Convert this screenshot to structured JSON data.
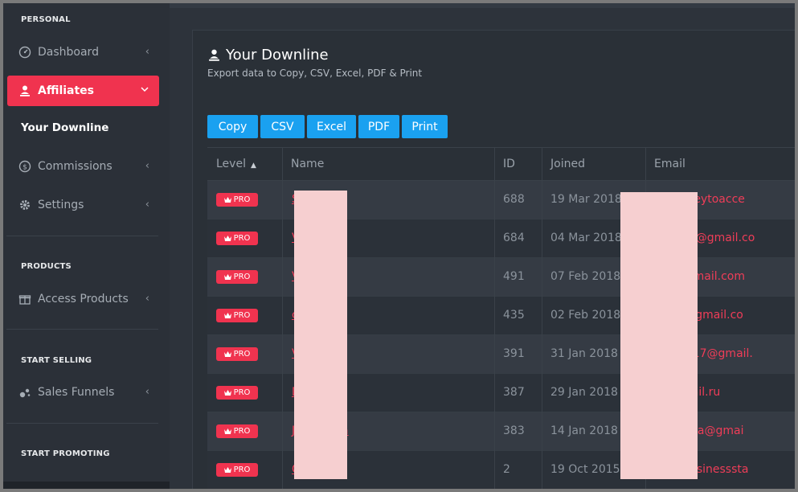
{
  "sidebar": {
    "sections": {
      "personal": "PERSONAL",
      "products": "PRODUCTS",
      "start_selling": "START SELLING",
      "start_promoting": "START PROMOTING"
    },
    "items": {
      "dashboard": "Dashboard",
      "affiliates": "Affiliates",
      "your_downline": "Your Downline",
      "commissions": "Commissions",
      "settings": "Settings",
      "access_products": "Access Products",
      "sales_funnels": "Sales Funnels"
    }
  },
  "main": {
    "title": "Your Downline",
    "subtitle": "Export data to Copy, CSV, Excel, PDF & Print",
    "buttons": [
      "Copy",
      "CSV",
      "Excel",
      "PDF",
      "Print"
    ],
    "table": {
      "headers": {
        "level": "Level",
        "name": "Name",
        "id": "ID",
        "joined": "Joined",
        "email": "Email"
      },
      "badge": "PRO",
      "rows": [
        {
          "name": "S        rey",
          "id": "688",
          "joined": "19 Mar 2018",
          "email": "mjourneytoacce"
        },
        {
          "name": "V",
          "id": "684",
          "joined": "04 Mar 2018",
          "email": "ella159@gmail.co"
        },
        {
          "name": "V",
          "id": "491",
          "joined": "07 Feb 2018",
          "email": "eyn@gmail.com"
        },
        {
          "name": "c",
          "id": "435",
          "joined": "02 Feb 2018",
          "email": "todor@gmail.co"
        },
        {
          "name": "V",
          "id": "391",
          "joined": "31 Jan 2018",
          "email": "ania2017@gmail."
        },
        {
          "name": "D        xoev",
          "id": "387",
          "joined": "29 Jan 2018",
          "email": "rm@mail.ru"
        },
        {
          "name": "J        zco Roca",
          "id": "383",
          "joined": "14 Jan 2018",
          "email": "ozcoroca@gmai"
        },
        {
          "name": "C        Babak",
          "id": "2",
          "joined": "19 Oct 2015",
          "email": "diy@businesssta"
        }
      ]
    }
  },
  "colors": {
    "accent": "#f0334f",
    "button": "#1aa1f0",
    "sidebar": "#2b3038",
    "card": "#2a3037"
  }
}
